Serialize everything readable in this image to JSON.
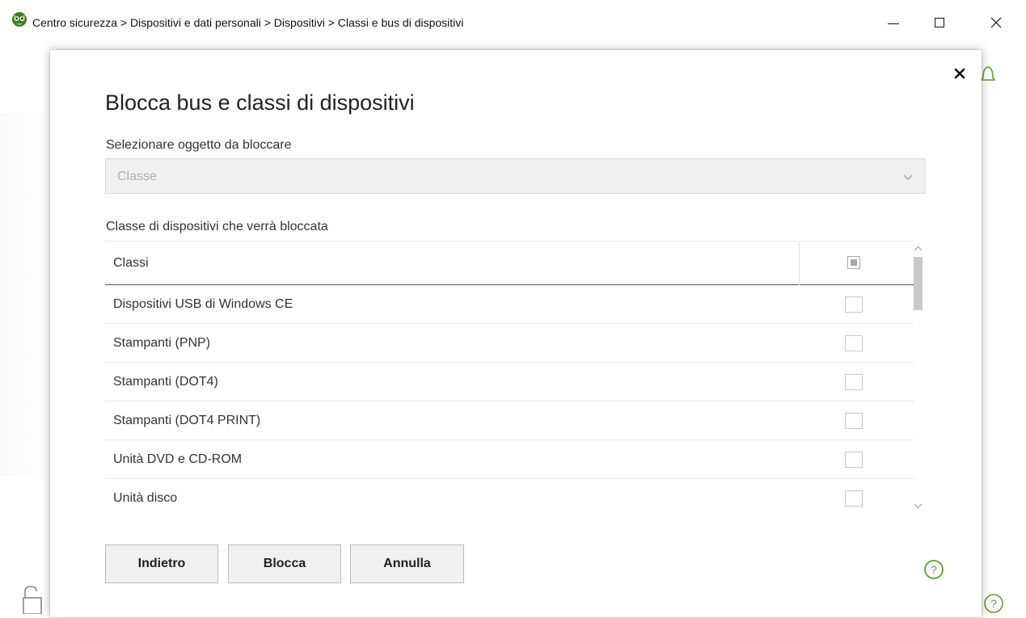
{
  "window": {
    "title": "Centro sicurezza > Dispositivi e dati personali > Dispositivi > Classi e bus di dispositivi",
    "icons": [
      "app-logo-icon",
      "minimize-icon",
      "maximize-icon",
      "close-icon"
    ]
  },
  "dialog": {
    "title": "Blocca bus e classi di dispositivi",
    "select_label": "Selezionare oggetto da bloccare",
    "select_value": "Classe",
    "classes_label": "Classe di dispositivi che verrà bloccata",
    "table": {
      "header": "Classi",
      "header_check_state": "indeterminate",
      "rows": [
        {
          "label": "Dispositivi USB di Windows CE",
          "checked": false
        },
        {
          "label": "Stampanti (PNP)",
          "checked": false
        },
        {
          "label": "Stampanti (DOT4)",
          "checked": false
        },
        {
          "label": "Stampanti (DOT4 PRINT)",
          "checked": false
        },
        {
          "label": "Unità DVD e CD-ROM",
          "checked": false
        },
        {
          "label": "Unità disco",
          "checked": false
        }
      ]
    },
    "buttons": {
      "back": "Indietro",
      "block": "Blocca",
      "cancel": "Annulla"
    }
  },
  "colors": {
    "accent_green": "#5aa02c",
    "disabled_field": "#f0f0f0",
    "button_bg": "#f0f0f0"
  }
}
